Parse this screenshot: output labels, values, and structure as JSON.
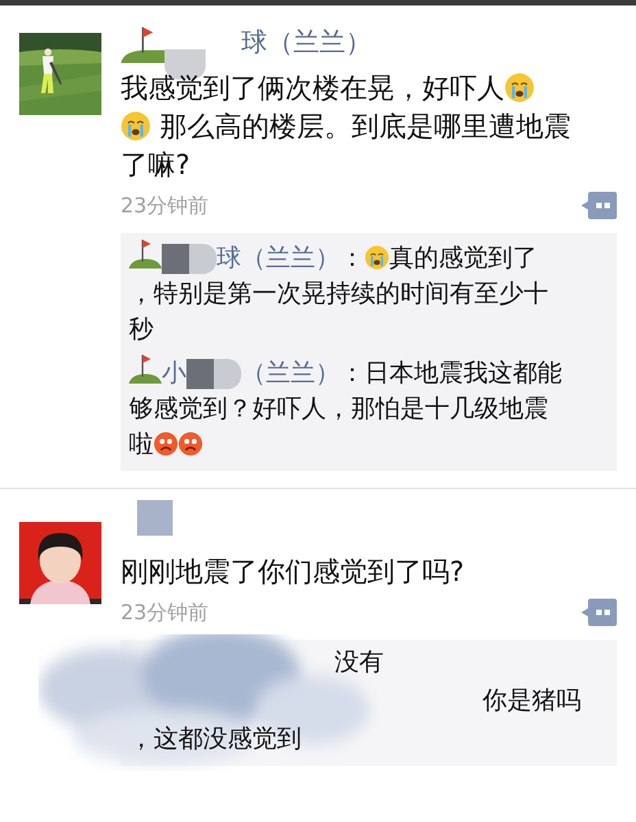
{
  "posts": [
    {
      "avatar": {
        "kind": "picture"
      },
      "name": "球（兰兰）",
      "text": [
        {
          "kind": "text",
          "text": "我感觉到了俩次楼在晃，好吓人"
        },
        {
          "kind": "crying"
        },
        {
          "kind": "crying",
          "newline": true
        },
        {
          "kind": "text",
          "text": " 那么高的楼层。到底是哪里遭地震"
        },
        {
          "kind": "text",
          "text": "了嘛?",
          "newline": true
        }
      ],
      "time": "23分钟前",
      "comments": [
        {
          "name": "球（兰兰）",
          "colon": "：",
          "parts": [
            {
              "kind": "crying"
            },
            {
              "kind": "text",
              "text": "真的感觉到了"
            },
            {
              "kind": "text",
              "text": "，特别是第一次晃持续的时间有至少十",
              "newline": true
            },
            {
              "kind": "text",
              "text": "秒",
              "newline": true
            }
          ]
        },
        {
          "name_prefix": "小",
          "name": "（兰兰）",
          "colon": "：",
          "parts": [
            {
              "kind": "text",
              "text": "日本地震我这都能"
            },
            {
              "kind": "text",
              "text": "够感觉到？好吓人，那怕是十几级地震",
              "newline": true
            },
            {
              "kind": "text",
              "text": "啦",
              "newline": true
            },
            {
              "kind": "angry"
            },
            {
              "kind": "angry"
            }
          ]
        }
      ]
    },
    {
      "avatar": {
        "kind": "picture"
      },
      "text": [
        {
          "kind": "text",
          "text": "刚刚地震了你们感觉到了吗?"
        }
      ],
      "time": "23分钟前",
      "comments": [
        {
          "parts": [
            {
              "kind": "text",
              "text": "没有"
            }
          ]
        },
        {
          "parts": [
            {
              "kind": "text",
              "text": "你是猪吗"
            }
          ]
        },
        {
          "parts": [
            {
              "kind": "text",
              "text": "，这都没感觉到"
            }
          ]
        }
      ]
    }
  ]
}
